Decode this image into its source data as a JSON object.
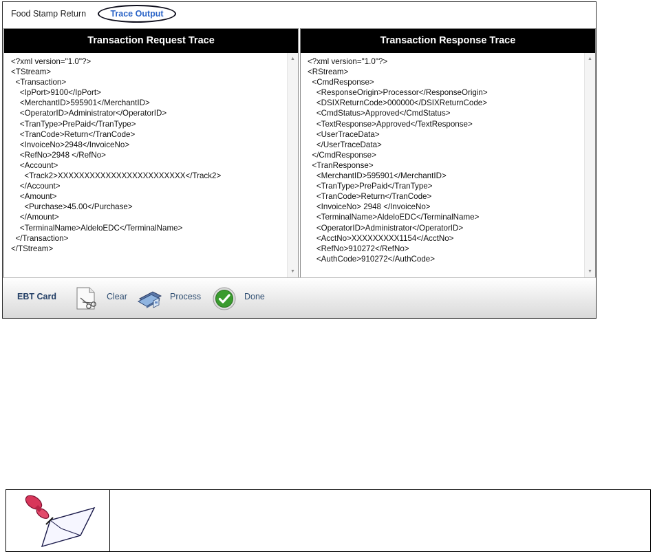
{
  "tabs": {
    "food_stamp_return": "Food Stamp Return",
    "trace_output": "Trace Output"
  },
  "request_panel": {
    "title": "Transaction Request Trace",
    "lines": [
      "<?xml version=\"1.0\"?>",
      "<TStream>",
      "  <Transaction>",
      "    <IpPort>9100</IpPort>",
      "    <MerchantID>595901</MerchantID>",
      "    <OperatorID>Administrator</OperatorID>",
      "    <TranType>PrePaid</TranType>",
      "    <TranCode>Return</TranCode>",
      "    <InvoiceNo>2948</InvoiceNo>",
      "    <RefNo>2948 </RefNo>",
      "    <Account>",
      "      <Track2>XXXXXXXXXXXXXXXXXXXXXXXX</Track2>",
      "    </Account>",
      "    <Amount>",
      "      <Purchase>45.00</Purchase>",
      "    </Amount>",
      "    <TerminalName>AldeloEDC</TerminalName>",
      "  </Transaction>",
      "</TStream>"
    ]
  },
  "response_panel": {
    "title": "Transaction Response Trace",
    "lines": [
      "<?xml version=\"1.0\"?>",
      "<RStream>",
      "  <CmdResponse>",
      "    <ResponseOrigin>Processor</ResponseOrigin>",
      "    <DSIXReturnCode>000000</DSIXReturnCode>",
      "    <CmdStatus>Approved</CmdStatus>",
      "    <TextResponse>Approved</TextResponse>",
      "    <UserTraceData>",
      "    </UserTraceData>",
      "  </CmdResponse>",
      "  <TranResponse>",
      "    <MerchantID>595901</MerchantID>",
      "    <TranType>PrePaid</TranType>",
      "    <TranCode>Return</TranCode>",
      "    <InvoiceNo> 2948 </InvoiceNo>",
      "    <TerminalName>AldeloEDC</TerminalName>",
      "    <OperatorID>Administrator</OperatorID>",
      "    <AcctNo>XXXXXXXXX1154</AcctNo>",
      "    <RefNo>910272</RefNo>",
      "    <AuthCode>910272</AuthCode>"
    ]
  },
  "toolbar": {
    "ebt_card": "EBT Card",
    "clear": "Clear",
    "process": "Process",
    "done": "Done",
    "icons": [
      "clear-scissors-icon",
      "process-card-icon",
      "done-checkmark-icon"
    ]
  },
  "note": {
    "icon": "pushpin-note-icon"
  },
  "colors": {
    "header_bg": "#000000",
    "active_tab": "#2d66c8",
    "toolbar_text": "#2f4e72",
    "done_green": "#3a9b2e"
  }
}
